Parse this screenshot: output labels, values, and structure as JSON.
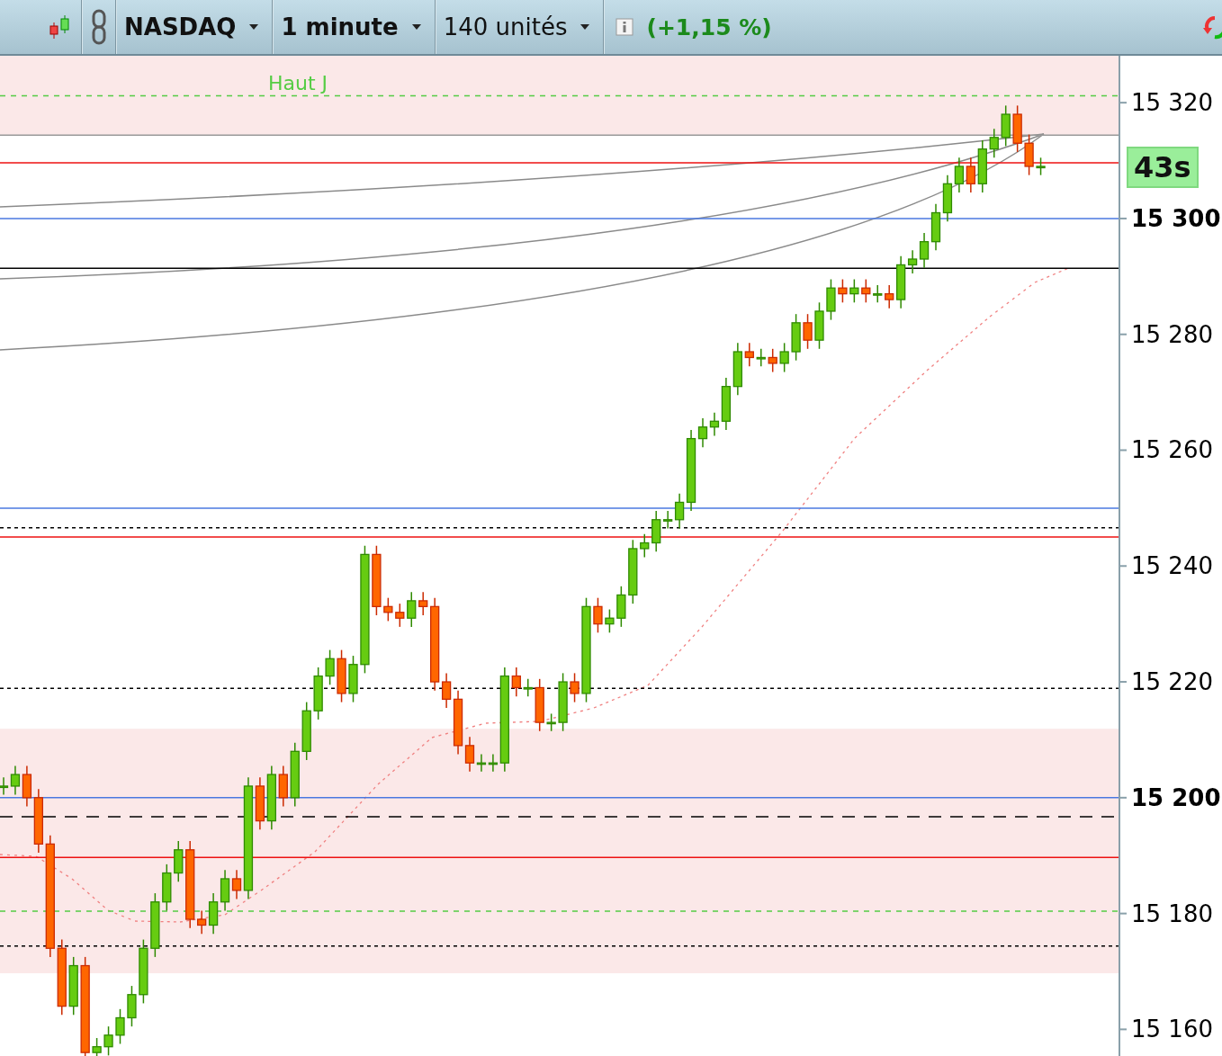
{
  "toolbar": {
    "instrument": "NASDAQ",
    "interval": "1 minute",
    "units": "140 unités",
    "change": "(+1,15 %)"
  },
  "chart": {
    "level_label": "Haut J",
    "countdown": "43s",
    "axis_labels": [
      {
        "text": "15 320",
        "bold": false
      },
      {
        "text": "15 300",
        "bold": true
      },
      {
        "text": "15 280",
        "bold": false
      },
      {
        "text": "15 260",
        "bold": false
      },
      {
        "text": "15 240",
        "bold": false
      },
      {
        "text": "15 220",
        "bold": false
      },
      {
        "text": "15 200",
        "bold": true
      },
      {
        "text": "15 180",
        "bold": false
      },
      {
        "text": "15 160",
        "bold": false
      }
    ]
  }
}
